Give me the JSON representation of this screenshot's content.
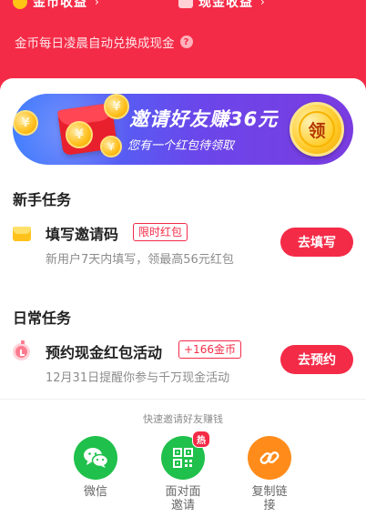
{
  "header": {
    "coin_earnings_label": "金币收益",
    "cash_earnings_label": "现金收益",
    "arrow_glyph": "›",
    "note": "金币每日凌晨自动兑换成现金",
    "help_glyph": "?",
    "bg_color": "#f42b47"
  },
  "banner": {
    "title": "邀请好友赚36元",
    "subtitle": "您有一个红包待领取",
    "get_button": "领",
    "coin_glyph": "¥"
  },
  "newbie_section": {
    "title": "新手任务",
    "task": {
      "name": "填写邀请码",
      "badge": "限时红包",
      "desc": "新用户7天内填写，领最高56元红包",
      "button": "去填写",
      "icon": "envelope-icon"
    }
  },
  "daily_section": {
    "title": "日常任务",
    "task": {
      "name": "预约现金红包活动",
      "badge": "+166金币",
      "desc": "12月31日提醒你参与千万现金活动",
      "button": "去预约",
      "icon": "alarm-clock-icon"
    }
  },
  "share": {
    "title": "快速邀请好友赚钱",
    "items": [
      {
        "label": "微信",
        "icon": "wechat-icon",
        "color": "#1fc04b"
      },
      {
        "label": "面对面邀请",
        "icon": "qr-code-icon",
        "color": "#1fc04b",
        "badge": "热"
      },
      {
        "label": "复制链接",
        "icon": "link-icon",
        "color": "#ff8c1a"
      }
    ]
  },
  "colors": {
    "accent_red": "#f42b47",
    "banner_blue": "#3c7bff",
    "banner_purple": "#7a3ce0",
    "gold": "#ffc21d"
  }
}
